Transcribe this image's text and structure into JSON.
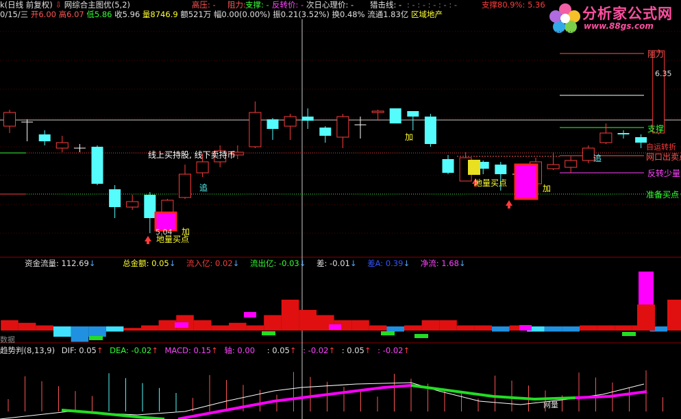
{
  "header": {
    "line1_left": "k(日线 前复权)",
    "indicator_name": "网综合主图优(5,2)",
    "gaoya": "高压: -",
    "zuli": "阻力: -",
    "zhicheng": "支撑: -",
    "fanzhuan": "反转价: -",
    "ciri": "次日心理价: -",
    "lieji": "猎击线: -",
    "dashes": ": - : - : - : - : -",
    "support_pct": "支撑80.9%: 5.36",
    "line2": {
      "date": "0/15/三",
      "open": "开6.00",
      "high": "高6.07",
      "low": "低5.86",
      "close": "收5.96",
      "volume": "量8746.9",
      "amount": "额521万",
      "change": "幅0.00(0.00%)",
      "amplitude": "振0.21(3.52%)",
      "turnover": "换0.48%",
      "float": "流通1.83亿",
      "sector": "区域地产"
    }
  },
  "logo": {
    "title": "分析家公式网",
    "url": "www.88gs.com"
  },
  "main_chart": {
    "price_high_label": "6.35",
    "price_low_label": "5.04",
    "annotations": {
      "hold": "线上买持股, 线下卖持币",
      "chase1": "追",
      "chase2": "追",
      "add1": "加",
      "add2": "加",
      "add3": "加",
      "buy1": "地量买点",
      "buy2": "地量买点"
    },
    "right_labels": {
      "resistance": "阻力",
      "support": "支撑",
      "sell_point": "网口出卖点",
      "reverse": "反转少量",
      "prepare_buy": "准备买点",
      "cross": "自运转折"
    },
    "candles": [
      {
        "o": 5.83,
        "c": 5.93,
        "h": 5.95,
        "l": 5.78
      },
      {
        "o": 5.86,
        "c": 5.86,
        "h": 5.88,
        "l": 5.72
      },
      {
        "o": 5.77,
        "c": 5.72,
        "h": 5.8,
        "l": 5.69
      },
      {
        "o": 5.67,
        "c": 5.71,
        "h": 5.76,
        "l": 5.64
      },
      {
        "o": 5.67,
        "c": 5.67,
        "h": 5.7,
        "l": 5.64
      },
      {
        "o": 5.68,
        "c": 5.41,
        "h": 5.69,
        "l": 5.4
      },
      {
        "o": 5.37,
        "c": 5.24,
        "h": 5.4,
        "l": 5.16
      },
      {
        "o": 5.24,
        "c": 5.28,
        "h": 5.33,
        "l": 5.22
      },
      {
        "o": 5.33,
        "c": 5.16,
        "h": 5.35,
        "l": 5.05
      },
      {
        "o": 5.19,
        "c": 5.29,
        "h": 5.3,
        "l": 5.17
      },
      {
        "o": 5.31,
        "c": 5.48,
        "h": 5.55,
        "l": 5.3
      },
      {
        "o": 5.49,
        "c": 5.57,
        "h": 5.63,
        "l": 5.46
      },
      {
        "o": 5.57,
        "c": 5.65,
        "h": 5.69,
        "l": 5.53
      },
      {
        "o": 5.62,
        "c": 5.64,
        "h": 5.69,
        "l": 5.59
      },
      {
        "o": 5.68,
        "c": 5.93,
        "h": 6.01,
        "l": 5.67
      },
      {
        "o": 5.88,
        "c": 5.81,
        "h": 5.89,
        "l": 5.73
      },
      {
        "o": 5.83,
        "c": 5.9,
        "h": 5.92,
        "l": 5.73
      },
      {
        "o": 5.9,
        "c": 5.87,
        "h": 5.96,
        "l": 5.81
      },
      {
        "o": 5.82,
        "c": 5.76,
        "h": 5.83,
        "l": 5.71
      },
      {
        "o": 5.75,
        "c": 5.9,
        "h": 5.92,
        "l": 5.67
      },
      {
        "o": 5.84,
        "c": 5.84,
        "h": 5.9,
        "l": 5.74
      },
      {
        "o": 5.93,
        "c": 5.94,
        "h": 5.95,
        "l": 5.87
      },
      {
        "o": 5.96,
        "c": 5.85,
        "h": 5.96,
        "l": 5.85
      },
      {
        "o": 5.94,
        "c": 5.9,
        "h": 5.94,
        "l": 5.8
      },
      {
        "o": 5.9,
        "c": 5.7,
        "h": 5.92,
        "l": 5.68
      },
      {
        "o": 5.59,
        "c": 5.49,
        "h": 5.62,
        "l": 5.48
      },
      {
        "o": 5.43,
        "c": 5.6,
        "h": 5.64,
        "l": 5.43
      },
      {
        "o": 5.57,
        "c": 5.52,
        "h": 5.58,
        "l": 5.48
      },
      {
        "o": 5.55,
        "c": 5.48,
        "h": 5.57,
        "l": 5.36
      },
      {
        "o": 5.48,
        "c": 5.48,
        "h": 5.52,
        "l": 5.44
      },
      {
        "o": 5.41,
        "c": 5.57,
        "h": 5.6,
        "l": 5.4
      },
      {
        "o": 5.52,
        "c": 5.55,
        "h": 5.64,
        "l": 5.51
      },
      {
        "o": 5.53,
        "c": 5.58,
        "h": 5.61,
        "l": 5.49
      },
      {
        "o": 5.58,
        "c": 5.67,
        "h": 5.69,
        "l": 5.56
      },
      {
        "o": 5.71,
        "c": 5.78,
        "h": 5.85,
        "l": 5.7
      },
      {
        "o": 5.78,
        "c": 5.77,
        "h": 5.8,
        "l": 5.74
      },
      {
        "o": 5.75,
        "c": 5.71,
        "h": 5.77,
        "l": 5.67
      },
      {
        "o": 5.78,
        "c": 6.38,
        "h": 6.39,
        "l": 5.77
      }
    ]
  },
  "fund_panel": {
    "flow": "资金流量: 112.69",
    "total": "总金额: 0.05",
    "inflow": "流入亿: 0.02",
    "outflow": "流出亿: -0.03",
    "diff": "差: -0.01",
    "ma": "差A: 0.39",
    "net": "净流: 1.68",
    "left_label": "数据",
    "values": [
      2,
      1.5,
      1,
      -2,
      -3,
      -2,
      -1,
      0.5,
      1,
      2,
      3,
      2,
      1,
      1.5,
      1,
      3,
      6,
      4,
      3,
      2,
      2,
      1,
      -1,
      1,
      2,
      2,
      1,
      1,
      -1,
      1,
      -1,
      -1,
      -1,
      1,
      1,
      1,
      1,
      -1,
      6
    ]
  },
  "macd_panel": {
    "title": "趋势判(8,13,9)",
    "dif": "DIF: 0.05",
    "dea": "DEA: -0.02",
    "macd": "MACD: 0.15",
    "axis": "轴: 0.00",
    "v1": ": 0.05",
    "v2": ": -0.02",
    "v3": ": 0.05",
    "v4": ": -0.02",
    "note": "网量"
  },
  "colors": {
    "up": "#ff3b3b",
    "down": "#54fcfc",
    "magenta": "#ff00ff",
    "green": "#00ff00",
    "yellow": "#ffff33",
    "grid": "#8b0000"
  }
}
